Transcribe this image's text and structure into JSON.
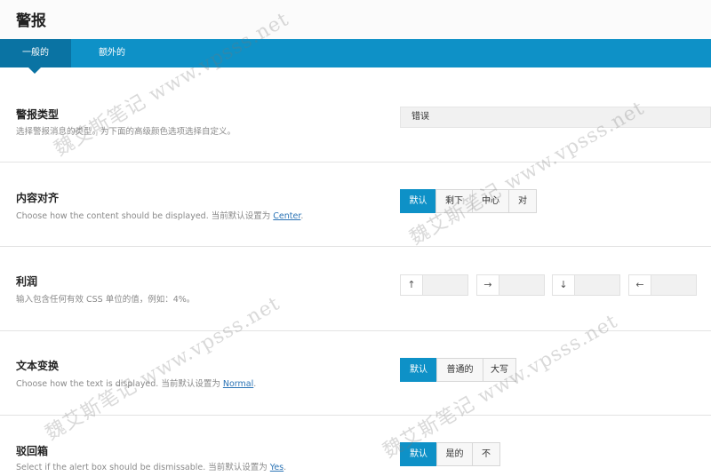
{
  "page": {
    "title": "警报"
  },
  "tabs": [
    {
      "label": "一般的",
      "active": true
    },
    {
      "label": "额外的",
      "active": false
    }
  ],
  "alert_type": {
    "label": "警报类型",
    "description": "选择警报消息的类型。为下面的高级颜色选项选择自定义。",
    "selected_value": "错误"
  },
  "content_align": {
    "label": "内容对齐",
    "desc_prefix": "Choose how the content should be displayed. 当前默认设置为 ",
    "desc_link": "Center",
    "desc_suffix": ".",
    "options": [
      "默认",
      "剩下",
      "中心",
      "对"
    ],
    "selected": "默认"
  },
  "margin": {
    "label": "利润",
    "description": "输入包含任何有效 CSS 单位的值，例如：4%。",
    "fields": [
      {
        "icon": "arrow-up-icon",
        "glyph": "↑",
        "value": ""
      },
      {
        "icon": "arrow-right-icon",
        "glyph": "→",
        "value": ""
      },
      {
        "icon": "arrow-down-icon",
        "glyph": "↓",
        "value": ""
      },
      {
        "icon": "arrow-left-icon",
        "glyph": "←",
        "value": ""
      }
    ]
  },
  "text_transform": {
    "label": "文本变换",
    "desc_prefix": "Choose how the text is displayed. 当前默认设置为 ",
    "desc_link": "Normal",
    "desc_suffix": ".",
    "options": [
      "默认",
      "普通的",
      "大写"
    ],
    "selected": "默认"
  },
  "dismissable": {
    "label": "驳回箱",
    "desc_prefix": "Select if the alert box should be dismissable. 当前默认设置为 ",
    "desc_link": "Yes",
    "desc_suffix": ".",
    "options": [
      "默认",
      "是的",
      "不"
    ],
    "selected": "默认"
  },
  "watermark": {
    "text": "魏艾斯笔记 www.vpsss.net"
  },
  "colors": {
    "primary": "#0e91c7",
    "tab_active": "#0a73a3",
    "link": "#2a73b5"
  }
}
